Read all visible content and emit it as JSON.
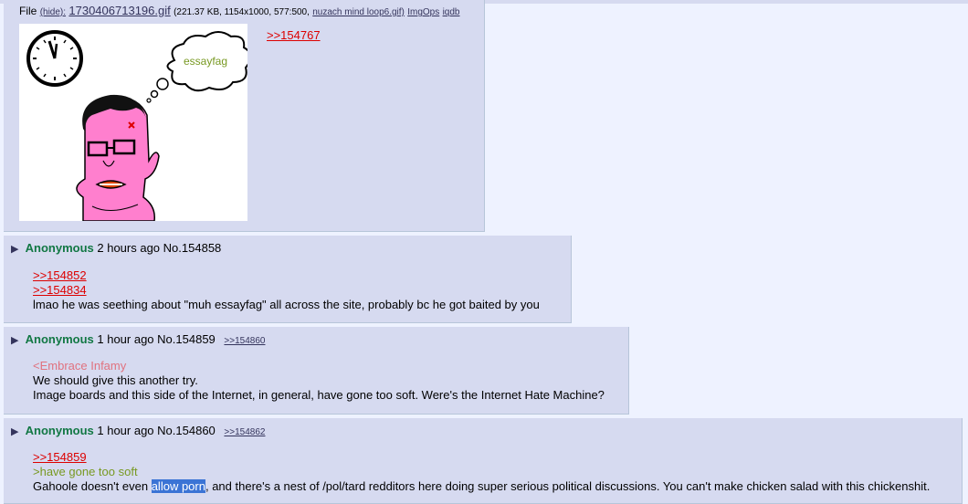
{
  "top_post": {
    "file_label": "File",
    "hide_link": "(hide):",
    "file_name": "1730406713196.gif",
    "file_meta": "(221.37 KB, 1154x1000, 577:500,",
    "orig_name": "nuzach mind loop6.gif)",
    "imgops": "ImgOps",
    "iqdb": "iqdb",
    "quotelink": ">>154767",
    "image_bubble_text": "essayfag"
  },
  "posts": [
    {
      "name": "Anonymous",
      "time": "2 hours ago",
      "no": "No.154858",
      "backlink": "",
      "lines": [
        ">>154852",
        ">>154834",
        "lmao he was seething about \"muh essayfag\" all across the site, probably bc he got baited by you"
      ]
    },
    {
      "name": "Anonymous",
      "time": "1 hour ago",
      "no": "No.154859",
      "backlink": ">>154860",
      "lines": [
        "<Embrace Infamy",
        "We should give this another try.",
        "Image boards and this side of the Internet, in general, have gone too soft. Were's the Internet Hate Machine?"
      ]
    },
    {
      "name": "Anonymous",
      "time": "1 hour ago",
      "no": "No.154860",
      "backlink": ">>154862",
      "lines": [
        ">>154859",
        ">have gone too soft",
        "Gahoole doesn't even",
        "allow porn",
        ", and there's a nest of /pol/tard redditors here doing super serious political discussions. You can't make chicken salad with this chickenshit."
      ]
    }
  ],
  "colors": {
    "reply_bg": "#d6daf0",
    "name": "#117743",
    "quotelink": "#dd0000",
    "greentext": "#789922",
    "pinktext": "#e0727f"
  }
}
